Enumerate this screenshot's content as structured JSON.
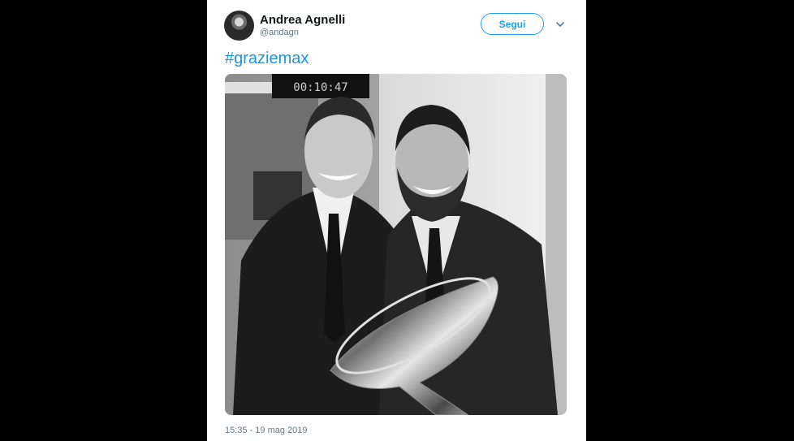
{
  "tweet": {
    "author_name": "Andrea Agnelli",
    "author_handle": "@andagn",
    "follow_label": "Segui",
    "text": "#graziemax",
    "timestamp": "15:35 - 19 mag 2019",
    "avatar_icon": "user-avatar",
    "menu_icon": "chevron-down-icon",
    "photo_clock_text": "00:10:47",
    "colors": {
      "accent": "#1da1f2",
      "hashtag": "#1b95e0",
      "name": "#14171a",
      "secondary": "#657786",
      "backdrop": "#000000"
    }
  }
}
